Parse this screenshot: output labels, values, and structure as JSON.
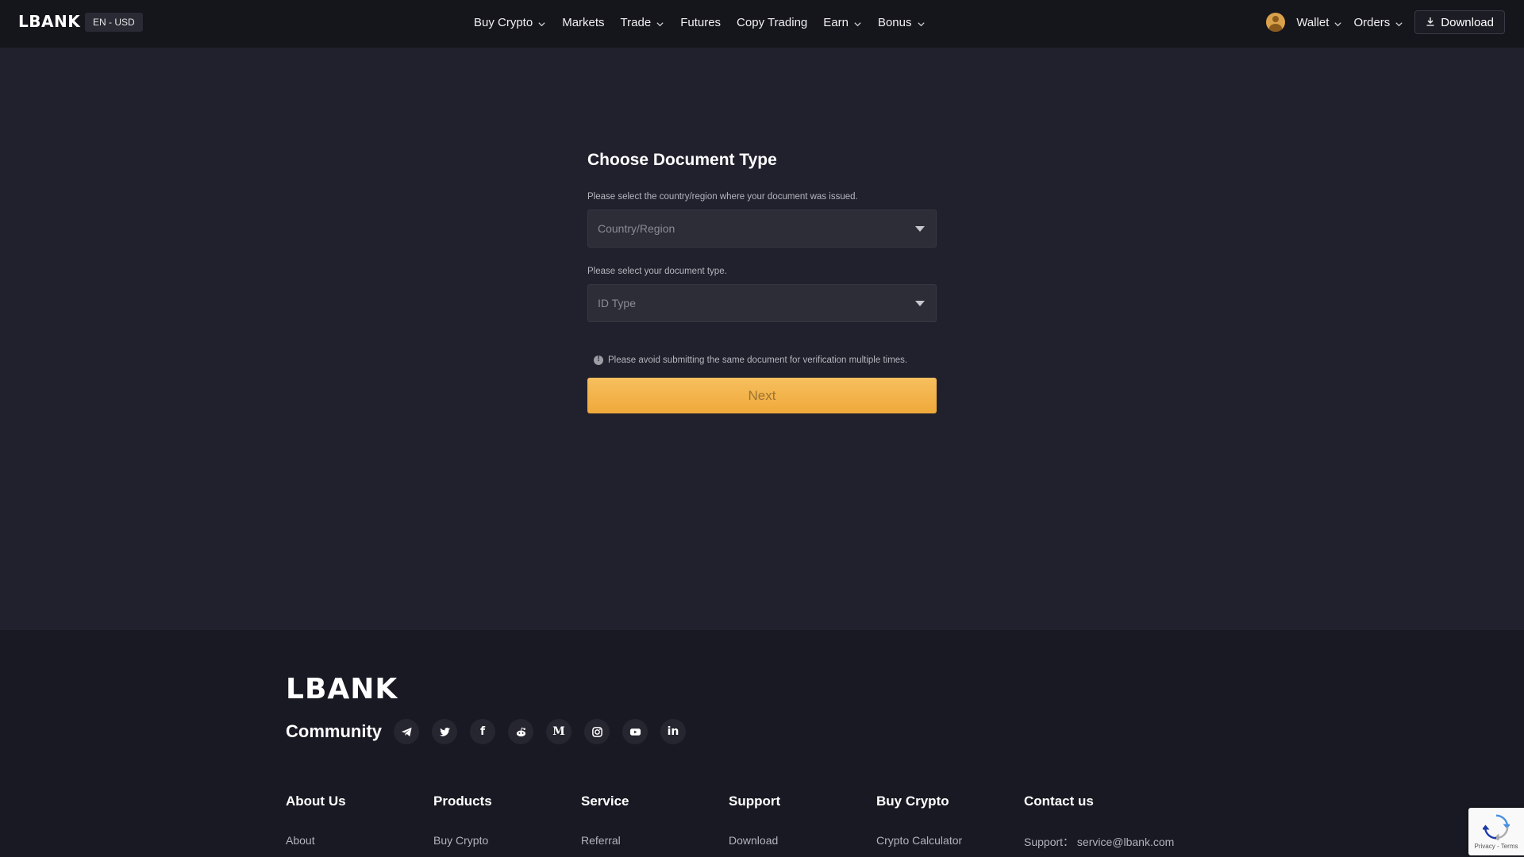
{
  "header": {
    "logo": "LBANK",
    "lang_currency": "EN - USD",
    "menu": [
      {
        "label": "Buy Crypto",
        "dropdown": true
      },
      {
        "label": "Markets",
        "dropdown": false
      },
      {
        "label": "Trade",
        "dropdown": true
      },
      {
        "label": "Futures",
        "dropdown": false
      },
      {
        "label": "Copy Trading",
        "dropdown": false
      },
      {
        "label": "Earn",
        "dropdown": true
      },
      {
        "label": "Bonus",
        "dropdown": true
      }
    ],
    "wallet_label": "Wallet",
    "orders_label": "Orders",
    "download_label": "Download"
  },
  "form": {
    "title": "Choose Document Type",
    "country_label": "Please select the country/region where your document was issued.",
    "country_placeholder": "Country/Region",
    "doc_label": "Please select your document type.",
    "doc_placeholder": "ID Type",
    "notice": "Please avoid submitting the same document for verification multiple times.",
    "next_label": "Next"
  },
  "footer": {
    "logo": "LBANK",
    "community_title": "Community",
    "socials": [
      "telegram-icon",
      "twitter-icon",
      "facebook-icon",
      "reddit-icon",
      "medium-icon",
      "instagram-icon",
      "youtube-icon",
      "linkedin-icon"
    ],
    "columns": [
      {
        "title": "About Us",
        "first_link": "About"
      },
      {
        "title": "Products",
        "first_link": "Buy Crypto"
      },
      {
        "title": "Service",
        "first_link": "Referral"
      },
      {
        "title": "Support",
        "first_link": "Download"
      },
      {
        "title": "Buy Crypto",
        "first_link": "Crypto Calculator"
      },
      {
        "title": "Contact us",
        "first_link": "Support： service@lbank.com"
      }
    ]
  },
  "recaptcha": {
    "terms": "Privacy - Terms"
  },
  "colors": {
    "page_bg": "#21212d",
    "nav_bg": "#15151c",
    "accent": "#f4b54c"
  }
}
